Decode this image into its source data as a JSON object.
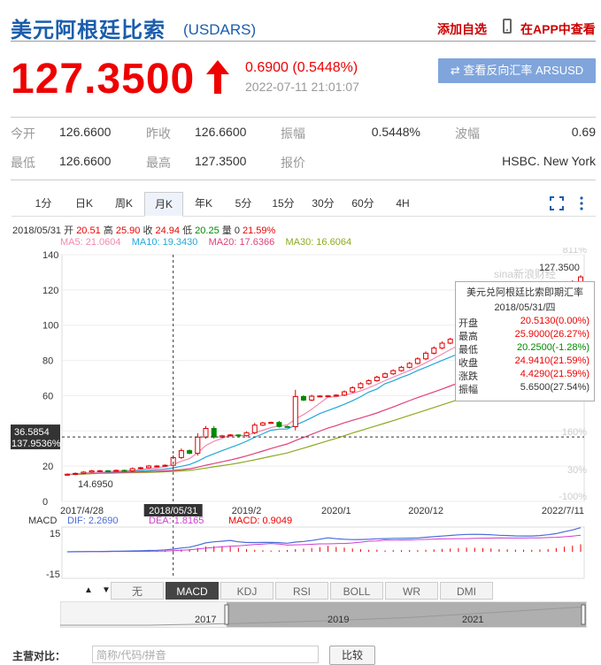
{
  "header": {
    "title": "美元阿根廷比索",
    "code": "(USDARS)",
    "add_watch": "添加自选",
    "view_app": "在APP中查看"
  },
  "quote": {
    "price": "127.3500",
    "change": "0.6900 (0.5448%)",
    "datetime": "2022-07-11 21:01:07",
    "reverse_button": "查看反向汇率 ARSUSD",
    "stats": [
      {
        "label": "今开",
        "value": "126.6600"
      },
      {
        "label": "昨收",
        "value": "126.6600"
      },
      {
        "label": "振幅",
        "value": "0.5448%"
      },
      {
        "label": "波幅",
        "value": "0.69"
      },
      {
        "label": "最低",
        "value": "126.6600"
      },
      {
        "label": "最高",
        "value": "127.3500"
      },
      {
        "label": "报价",
        "value": "HSBC. New York"
      }
    ],
    "up_color": "#e00000",
    "down_color": "#008800"
  },
  "chart_tabs": [
    "1分",
    "日K",
    "周K",
    "月K",
    "年K",
    "5分",
    "15分",
    "30分",
    "60分",
    "4H"
  ],
  "chart_tabs_active": "月K",
  "info_line": {
    "date": "2018/05/31",
    "open_label": "开",
    "open": "20.51",
    "high_label": "高",
    "high": "25.90",
    "close_label": "收",
    "close": "24.94",
    "low_label": "低",
    "low": "20.25",
    "vol_label": "量",
    "vol": "0",
    "pct": "21.59%"
  },
  "ma": {
    "ma5": "MA5: 21.0604",
    "ma10": "MA10: 19.3430",
    "ma20": "MA20: 17.6366",
    "ma30": "MA30: 16.6064"
  },
  "chart_data": {
    "type": "candlestick",
    "ylim": [
      0,
      140
    ],
    "y_ticks": [
      0,
      20,
      40,
      60,
      80,
      100,
      120,
      140
    ],
    "y_tick_labels": [
      "0",
      "20",
      "40",
      "60",
      "80",
      "100",
      "120",
      "140"
    ],
    "pct_ticks": [
      "811%",
      "160%",
      "30%",
      "-100%"
    ],
    "x_tick_labels": [
      "2017/4/28",
      "2018/05/31",
      "2019/2",
      "2020/1",
      "2020/12",
      "2022/7/11"
    ],
    "last_price_label": "127.3500",
    "low_label": "14.6950",
    "crosshair_value": "36.5854",
    "crosshair_pct": "137.9536%",
    "crosshair_date": "2018/05/31",
    "watermark": "sina新浪财经",
    "months": [
      "2017/4",
      "2017/5",
      "2017/6",
      "2017/7",
      "2017/8",
      "2017/9",
      "2017/10",
      "2017/11",
      "2017/12",
      "2018/1",
      "2018/2",
      "2018/3",
      "2018/4",
      "2018/5",
      "2018/6",
      "2018/7",
      "2018/8",
      "2018/9",
      "2018/10",
      "2018/11",
      "2018/12",
      "2019/1",
      "2019/2",
      "2019/3",
      "2019/4",
      "2019/5",
      "2019/6",
      "2019/7",
      "2019/8",
      "2019/9",
      "2019/10",
      "2019/11",
      "2019/12",
      "2020/1",
      "2020/2",
      "2020/3",
      "2020/4",
      "2020/5",
      "2020/6",
      "2020/7",
      "2020/8",
      "2020/9",
      "2020/10",
      "2020/11",
      "2020/12",
      "2021/1",
      "2021/2",
      "2021/3",
      "2021/4",
      "2021/5",
      "2021/6",
      "2021/7",
      "2021/8",
      "2021/9",
      "2021/10",
      "2021/11",
      "2021/12",
      "2022/1",
      "2022/2",
      "2022/3",
      "2022/4",
      "2022/5",
      "2022/6",
      "2022/7"
    ],
    "close": [
      15.4,
      15.9,
      16.6,
      17.3,
      17.4,
      17.3,
      17.6,
      17.4,
      18.6,
      19.1,
      20.1,
      20.1,
      20.5,
      24.9,
      28.8,
      27.3,
      36.5,
      41.4,
      36.5,
      37.2,
      37.7,
      37.3,
      39.0,
      43.3,
      44.5,
      44.8,
      42.5,
      42.4,
      59.5,
      57.5,
      59.7,
      59.8,
      59.9,
      60.3,
      62.2,
      64.5,
      66.8,
      68.5,
      70.5,
      72.4,
      74.2,
      76.1,
      78.3,
      80.9,
      84.1,
      87.0,
      89.8,
      92.0,
      93.3,
      94.7,
      95.8,
      96.9,
      97.8,
      98.7,
      99.6,
      101.1,
      102.7,
      105.0,
      107.9,
      110.9,
      114.9,
      119.0,
      124.1,
      127.35
    ],
    "ma5": [
      15.4,
      15.6,
      16.0,
      16.3,
      16.5,
      16.9,
      17.2,
      17.4,
      17.7,
      18.0,
      18.6,
      19.0,
      19.7,
      20.9,
      22.8,
      24.3,
      27.6,
      31.7,
      34.1,
      35.8,
      37.8,
      37.2,
      37.5,
      38.9,
      40.4,
      41.9,
      42.8,
      43.4,
      46.7,
      49.3,
      52.3,
      55.8,
      59.2,
      59.4,
      60.4,
      61.3,
      62.7,
      64.5,
      66.5,
      68.5,
      70.5,
      72.4,
      74.3,
      76.4,
      78.7,
      81.1,
      83.6,
      86.1,
      88.5,
      90.8,
      92.5,
      93.9,
      95.1,
      96.1,
      97.2,
      98.4,
      99.8,
      101.4,
      103.5,
      106.1,
      109.3,
      113.3,
      117.4,
      122.1
    ],
    "ma10": [
      15.4,
      15.6,
      16.0,
      16.3,
      16.5,
      16.6,
      16.8,
      16.9,
      17.1,
      17.3,
      17.6,
      18.0,
      18.3,
      19.0,
      19.9,
      20.9,
      22.8,
      25.2,
      27.0,
      28.8,
      30.5,
      32.2,
      34.1,
      36.4,
      38.4,
      40.4,
      41.0,
      41.1,
      43.3,
      45.3,
      47.5,
      49.9,
      51.6,
      53.3,
      55.1,
      57.1,
      59.4,
      62.0,
      63.8,
      66.8,
      68.4,
      70.4,
      72.1,
      74.3,
      76.1,
      78.1,
      80.0,
      81.9,
      83.8,
      85.5,
      87.4,
      89.2,
      90.9,
      92.7,
      94.1,
      95.7,
      97.2,
      98.9,
      100.6,
      102.6,
      104.6,
      107.0,
      109.7,
      112.6
    ],
    "ma20": [
      15.4,
      15.5,
      15.8,
      16.0,
      16.2,
      16.3,
      16.4,
      16.5,
      16.6,
      16.7,
      16.9,
      17.1,
      17.3,
      17.6,
      18.0,
      18.5,
      19.4,
      20.5,
      21.5,
      22.5,
      23.5,
      24.6,
      25.8,
      27.2,
      28.6,
      30.0,
      31.3,
      32.6,
      34.5,
      36.3,
      38.1,
      39.9,
      41.6,
      43.0,
      44.6,
      46.0,
      47.3,
      48.7,
      50.2,
      51.9,
      53.6,
      55.4,
      57.2,
      58.9,
      60.5,
      62.1,
      63.8,
      65.5,
      67.2,
      68.9,
      70.5,
      72.1,
      73.7,
      75.3,
      76.8,
      78.4,
      79.9,
      81.5,
      83.1,
      84.7,
      86.4,
      88.1,
      89.9,
      91.8
    ],
    "ma30": [
      15.2,
      15.3,
      15.5,
      15.7,
      15.9,
      16.0,
      16.1,
      16.2,
      16.3,
      16.4,
      16.5,
      16.6,
      16.8,
      17.0,
      17.3,
      17.6,
      18.2,
      18.9,
      19.6,
      20.3,
      21.0,
      21.8,
      22.7,
      23.6,
      24.6,
      25.6,
      26.5,
      27.5,
      28.9,
      30.2,
      31.6,
      33.0,
      34.4,
      35.8,
      37.3,
      38.8,
      40.2,
      41.6,
      43.0,
      44.4,
      45.8,
      47.3,
      48.8,
      50.3,
      51.8,
      53.3,
      54.8,
      56.3,
      57.8,
      59.3,
      60.8,
      62.3,
      63.8,
      65.3,
      66.8,
      68.3,
      69.8,
      71.3,
      72.8,
      74.3,
      75.9,
      77.5,
      79.1,
      80.8
    ]
  },
  "macd": {
    "label": "MACD",
    "dif": "DIF: 2.2690",
    "dea": "DEA: 1.8165",
    "macd": "MACD: 0.9049",
    "y_ticks": [
      "15",
      "-15"
    ]
  },
  "tooltip": {
    "title": "美元兑阿根廷比索即期汇率",
    "date": "2018/05/31/四",
    "rows": [
      {
        "k": "开盘",
        "v": "20.5130(0.00%)",
        "c": "up"
      },
      {
        "k": "最高",
        "v": "25.9000(26.27%)",
        "c": "up"
      },
      {
        "k": "最低",
        "v": "20.2500(-1.28%)",
        "c": "down"
      },
      {
        "k": "收盘",
        "v": "24.9410(21.59%)",
        "c": "up"
      },
      {
        "k": "涨跌",
        "v": "4.4290(21.59%)",
        "c": "up"
      },
      {
        "k": "振幅",
        "v": "5.6500(27.54%)",
        "c": "flat"
      }
    ]
  },
  "indicators": [
    "无",
    "MACD",
    "KDJ",
    "RSI",
    "BOLL",
    "WR",
    "DMI"
  ],
  "indicators_active": "MACD",
  "navigator_years": [
    "2017",
    "2019",
    "2021"
  ],
  "footer": {
    "compare_label": "主营对比：",
    "search_placeholder": "简称/代码/拼音",
    "compare_button": "比较"
  }
}
